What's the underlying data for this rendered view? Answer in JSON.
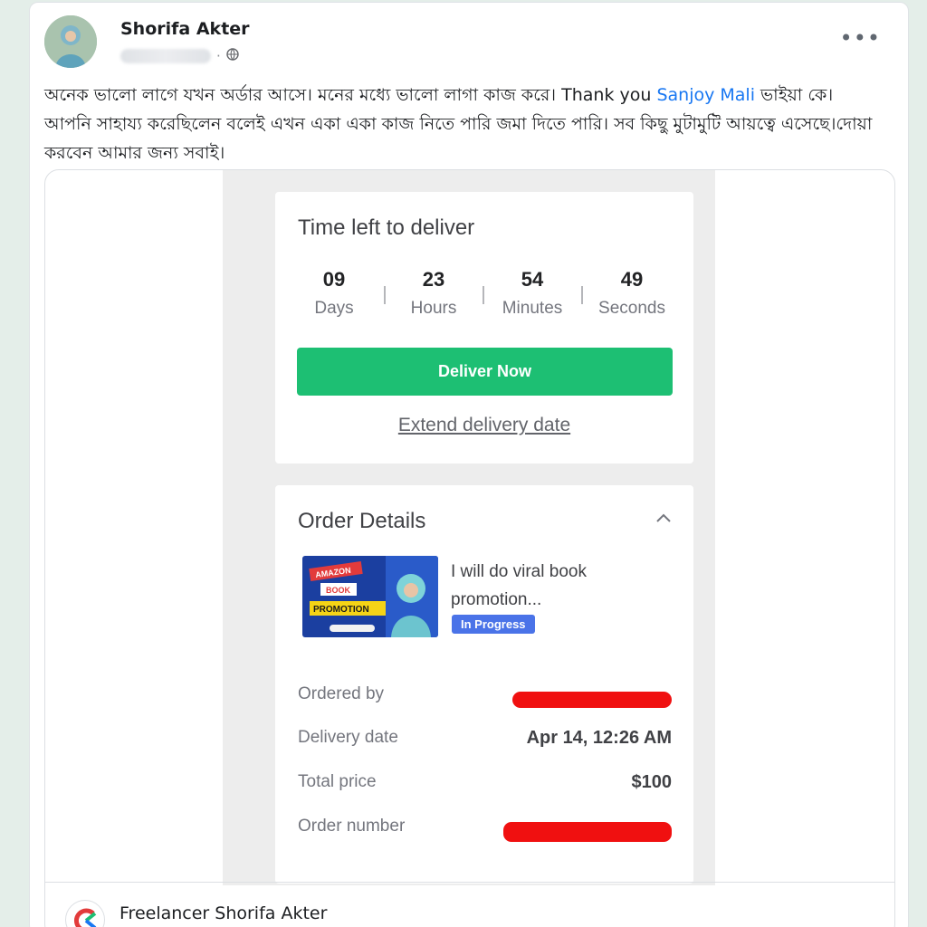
{
  "post": {
    "author": "Shorifa Akter",
    "more_label": "•••",
    "text_before_mention": "অনেক ভালো লাগে যখন অর্ডার আসে। মনের মধ্যে ভালো লাগা কাজ করে। Thank you ",
    "mention": "Sanjoy Mali",
    "text_after_mention": " ভাইয়া কে। আপনি সাহায্য করেছিলেন বলেই এখন একা একা কাজ নিতে পারি জমা দিতে পারি। সব কিছু মুটামুটি আয়ত্বে এসেছে।দোয়া করবেন আমার জন্য সবাই।"
  },
  "delivery": {
    "title": "Time left to deliver",
    "countdown": [
      {
        "num": "09",
        "label": "Days"
      },
      {
        "num": "23",
        "label": "Hours"
      },
      {
        "num": "54",
        "label": "Minutes"
      },
      {
        "num": "49",
        "label": "Seconds"
      }
    ],
    "deliver_button": "Deliver Now",
    "extend_link": "Extend delivery date"
  },
  "order": {
    "title": "Order Details",
    "thumb_text": [
      "AMAZON",
      "BOOK",
      "PROMOTION"
    ],
    "gig_title": "I will do viral book promotion...",
    "status": "In Progress",
    "rows": [
      {
        "key": "Ordered by",
        "value": ""
      },
      {
        "key": "Delivery date",
        "value": "Apr 14, 12:26 AM"
      },
      {
        "key": "Total price",
        "value": "$100"
      },
      {
        "key": "Order number",
        "value": ""
      }
    ]
  },
  "shared_page": {
    "name": "Freelancer Shorifa Akter"
  },
  "colors": {
    "accent_green": "#1dbf73",
    "mention_blue": "#1877f2",
    "status_blue": "#4a73e8",
    "redaction_red": "#f01010"
  },
  "icons": [
    "globe-icon",
    "more-icon",
    "chevron-up-icon"
  ]
}
